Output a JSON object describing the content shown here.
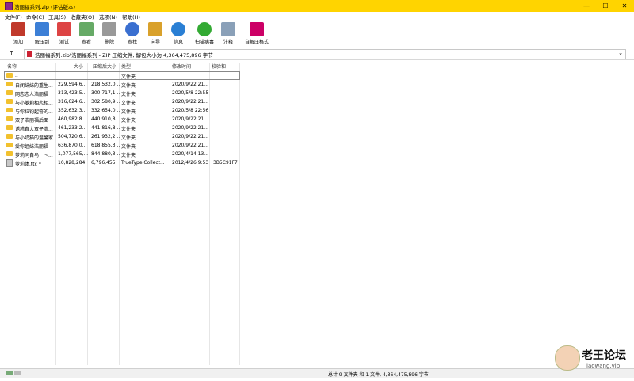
{
  "window": {
    "title": "浩丽福系列.zip (评估版本)",
    "controls": [
      "—",
      "☐",
      "✕"
    ]
  },
  "menu": [
    "文件(F)",
    "命令(C)",
    "工具(S)",
    "收藏夹(O)",
    "选项(N)",
    "帮助(H)"
  ],
  "toolbar": [
    {
      "label": "添加",
      "icon": "add-icon",
      "color": "#c0392b"
    },
    {
      "label": "解压到",
      "icon": "extract-folder-icon",
      "color": "#3c7fd6"
    },
    {
      "label": "测试",
      "icon": "test-icon",
      "color": "#d44"
    },
    {
      "label": "查看",
      "icon": "view-icon",
      "color": "#6a6"
    },
    {
      "label": "删除",
      "icon": "trash-icon",
      "color": "#999"
    },
    {
      "label": "查找",
      "icon": "magnifier-icon",
      "color": "#3a6fd0"
    },
    {
      "label": "向导",
      "icon": "wizard-icon",
      "color": "#d9a12b"
    },
    {
      "label": "信息",
      "icon": "info-icon",
      "color": "#2a7fd4"
    },
    {
      "label": "扫描病毒",
      "icon": "virus-scan-icon",
      "color": "#3a3"
    },
    {
      "label": "注释",
      "icon": "comment-icon",
      "color": "#8aa0b8"
    },
    {
      "label": "自解压格式",
      "icon": "sfx-icon",
      "color": "#c06"
    }
  ],
  "address": {
    "path": "浩丽福系列.zip\\浩丽福系列 - ZIP 压缩文件, 解包大小为 4,364,475,896 字节"
  },
  "columns": [
    "名称",
    "大小",
    "压缩后大小",
    "类型",
    "修改时间",
    "校验和"
  ],
  "rows": [
    {
      "name": "..",
      "size": "",
      "packed": "",
      "type": "文件夹",
      "modified": "",
      "crc": "",
      "kind": "up"
    },
    {
      "name": "自闭妹妹的重生...",
      "size": "229,594,6...",
      "packed": "218,532,0...",
      "type": "文件夹",
      "modified": "2020/9/22 21...",
      "crc": "",
      "kind": "folder"
    },
    {
      "name": "网恋恋人浩丽福",
      "size": "313,423,5...",
      "packed": "300,717,1...",
      "type": "文件夹",
      "modified": "2020/5/8 22:55",
      "crc": "",
      "kind": "folder"
    },
    {
      "name": "与小萝莉相恋相...",
      "size": "316,624,6...",
      "packed": "302,580,9...",
      "type": "文件夹",
      "modified": "2020/9/22 21...",
      "crc": "",
      "kind": "folder"
    },
    {
      "name": "与你拉钩起誓的...",
      "size": "352,632,3...",
      "packed": "332,654,0...",
      "type": "文件夹",
      "modified": "2020/5/8 22:56",
      "crc": "",
      "kind": "folder"
    },
    {
      "name": "双子浩丽福后面",
      "size": "460,982,8...",
      "packed": "440,910,8...",
      "type": "文件夹",
      "modified": "2020/9/22 21...",
      "crc": "",
      "kind": "folder"
    },
    {
      "name": "诱惑自大双子浩...",
      "size": "461,233,2...",
      "packed": "441,816,8...",
      "type": "文件夹",
      "modified": "2020/9/22 21...",
      "crc": "",
      "kind": "folder"
    },
    {
      "name": "与小奶猫的温馨家",
      "size": "504,720,6...",
      "packed": "261,932,2...",
      "type": "文件夹",
      "modified": "2020/9/22 21...",
      "crc": "",
      "kind": "folder"
    },
    {
      "name": "爱你姐妹浩丽福",
      "size": "636,870,0...",
      "packed": "618,855,3...",
      "type": "文件夹",
      "modified": "2020/9/22 21...",
      "crc": "",
      "kind": "folder"
    },
    {
      "name": "萝莉同自鸟！～...",
      "size": "1,077,565,...",
      "packed": "844,880,3...",
      "type": "文件夹",
      "modified": "2020/4/14 13...",
      "crc": "",
      "kind": "folder"
    },
    {
      "name": "萝莉体.ttc *",
      "size": "10,828,284",
      "packed": "6,796,455",
      "type": "TrueType Collect...",
      "modified": "2012/4/26 9:53",
      "crc": "3B5C91F7",
      "kind": "file"
    }
  ],
  "status": "总计 9 文件夹 和 1 文件, 4,364,475,896 字节",
  "watermark": {
    "title": "老王论坛",
    "sub": "laowang.vip"
  }
}
